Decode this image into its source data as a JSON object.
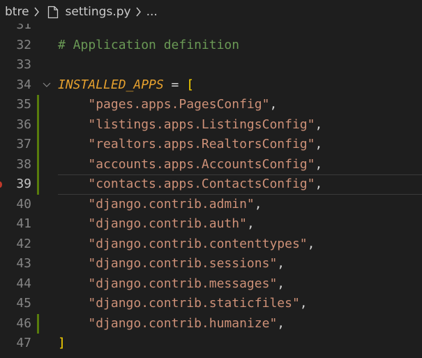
{
  "breadcrumb": {
    "root": "btre",
    "file": "settings.py",
    "more": "...",
    "icons": [
      "chevron-right-icon",
      "file-icon",
      "chevron-right-icon"
    ]
  },
  "colors": {
    "background": "#1e1e1e",
    "line_number": "#858585",
    "comment": "#6a9955",
    "constant": "#e5a02e",
    "bracket": "#ffd700",
    "string": "#ce9178",
    "modified_gutter": "#587c0c"
  },
  "lines": [
    {
      "num": "31",
      "modified": false,
      "tokens": []
    },
    {
      "num": "32",
      "modified": false,
      "tokens": [
        {
          "t": "comment",
          "v": "# Application definition"
        }
      ]
    },
    {
      "num": "33",
      "modified": false,
      "tokens": []
    },
    {
      "num": "34",
      "modified": false,
      "fold": true,
      "tokens": [
        {
          "t": "const",
          "v": "INSTALLED_APPS"
        },
        {
          "t": "op",
          "v": " = "
        },
        {
          "t": "bracket",
          "v": "["
        }
      ]
    },
    {
      "num": "35",
      "modified": true,
      "tokens": [
        {
          "t": "indent",
          "v": "    "
        },
        {
          "t": "str",
          "v": "\"pages.apps.PagesConfig\""
        },
        {
          "t": "punc",
          "v": ","
        }
      ]
    },
    {
      "num": "36",
      "modified": true,
      "tokens": [
        {
          "t": "indent",
          "v": "    "
        },
        {
          "t": "str",
          "v": "\"listings.apps.ListingsConfig\""
        },
        {
          "t": "punc",
          "v": ","
        }
      ]
    },
    {
      "num": "37",
      "modified": true,
      "tokens": [
        {
          "t": "indent",
          "v": "    "
        },
        {
          "t": "str",
          "v": "\"realtors.apps.RealtorsConfig\""
        },
        {
          "t": "punc",
          "v": ","
        }
      ]
    },
    {
      "num": "38",
      "modified": true,
      "tokens": [
        {
          "t": "indent",
          "v": "    "
        },
        {
          "t": "str",
          "v": "\"accounts.apps.AccountsConfig\""
        },
        {
          "t": "punc",
          "v": ","
        }
      ]
    },
    {
      "num": "39",
      "modified": true,
      "current": true,
      "breakpoint": true,
      "tokens": [
        {
          "t": "indent",
          "v": "    "
        },
        {
          "t": "str",
          "v": "\"contacts.apps.ContactsConfig\""
        },
        {
          "t": "punc",
          "v": ","
        }
      ]
    },
    {
      "num": "40",
      "modified": false,
      "tokens": [
        {
          "t": "indent",
          "v": "    "
        },
        {
          "t": "str",
          "v": "\"django.contrib.admin\""
        },
        {
          "t": "punc",
          "v": ","
        }
      ]
    },
    {
      "num": "41",
      "modified": false,
      "tokens": [
        {
          "t": "indent",
          "v": "    "
        },
        {
          "t": "str",
          "v": "\"django.contrib.auth\""
        },
        {
          "t": "punc",
          "v": ","
        }
      ]
    },
    {
      "num": "42",
      "modified": false,
      "tokens": [
        {
          "t": "indent",
          "v": "    "
        },
        {
          "t": "str",
          "v": "\"django.contrib.contenttypes\""
        },
        {
          "t": "punc",
          "v": ","
        }
      ]
    },
    {
      "num": "43",
      "modified": false,
      "tokens": [
        {
          "t": "indent",
          "v": "    "
        },
        {
          "t": "str",
          "v": "\"django.contrib.sessions\""
        },
        {
          "t": "punc",
          "v": ","
        }
      ]
    },
    {
      "num": "44",
      "modified": false,
      "tokens": [
        {
          "t": "indent",
          "v": "    "
        },
        {
          "t": "str",
          "v": "\"django.contrib.messages\""
        },
        {
          "t": "punc",
          "v": ","
        }
      ]
    },
    {
      "num": "45",
      "modified": false,
      "tokens": [
        {
          "t": "indent",
          "v": "    "
        },
        {
          "t": "str",
          "v": "\"django.contrib.staticfiles\""
        },
        {
          "t": "punc",
          "v": ","
        }
      ]
    },
    {
      "num": "46",
      "modified": true,
      "tokens": [
        {
          "t": "indent",
          "v": "    "
        },
        {
          "t": "str",
          "v": "\"django.contrib.humanize\""
        },
        {
          "t": "punc",
          "v": ","
        }
      ]
    },
    {
      "num": "47",
      "modified": false,
      "tokens": [
        {
          "t": "bracket",
          "v": "]"
        }
      ]
    }
  ]
}
